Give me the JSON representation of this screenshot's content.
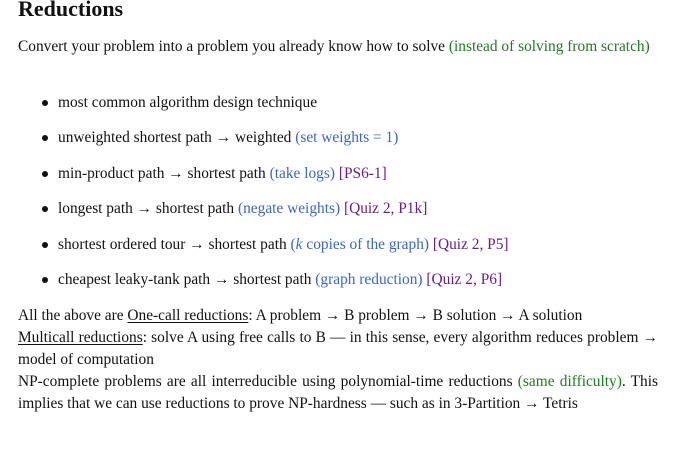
{
  "title": "Reductions",
  "intro": {
    "text": "Convert your problem into a problem you already know how to solve ",
    "note": "(instead of solving from scratch)"
  },
  "bullets": [
    {
      "main": "most common algorithm design technique",
      "note": "",
      "ref": ""
    },
    {
      "main": "unweighted shortest path → weighted ",
      "note": "(set weights = 1)",
      "ref": ""
    },
    {
      "main": "min-product path → shortest path ",
      "note": "(take logs)",
      "ref": " [PS6-1]"
    },
    {
      "main": "longest path → shortest path ",
      "note": "(negate weights)",
      "ref": " [Quiz 2, P1k]"
    },
    {
      "main": "shortest ordered tour → shortest path ",
      "note_var": "k",
      "note": " copies of the graph)",
      "ref": " [Quiz 2, P5]"
    },
    {
      "main": "cheapest leaky-tank path → shortest path ",
      "note": "(graph reduction)",
      "ref": " [Quiz 2, P6]"
    }
  ],
  "one_call": {
    "prefix": "All the above are ",
    "term": "One-call reductions",
    "rest": ": A problem → B problem → B solution → A solution"
  },
  "multicall": {
    "term": "Multicall reductions",
    "rest": ": solve A using free calls to B — in this sense, every algorithm reduces problem → model of computation"
  },
  "np": {
    "text1": "NP-complete problems are all interreducible using polynomial-time reductions ",
    "note": "(same difficulty)",
    "text2": ". This implies that we can use reductions to prove NP-hardness — such as in 3-Partition → Tetris"
  }
}
